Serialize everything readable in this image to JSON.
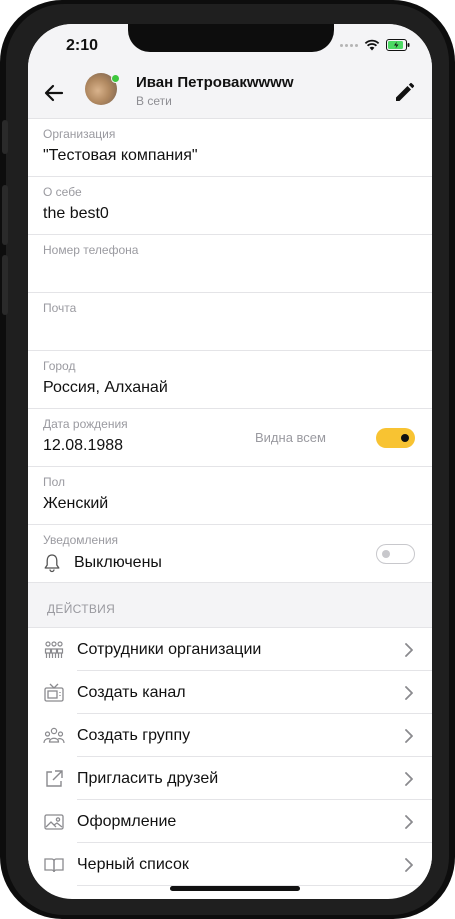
{
  "status_bar": {
    "time": "2:10"
  },
  "header": {
    "name": "Иван Петровакwwww",
    "presence": "В сети"
  },
  "profile": {
    "organization": {
      "label": "Организация",
      "value": "\"Тестовая компания\""
    },
    "about": {
      "label": "О себе",
      "value": "the best0"
    },
    "phone": {
      "label": "Номер телефона",
      "value": ""
    },
    "email": {
      "label": "Почта",
      "value": ""
    },
    "city": {
      "label": "Город",
      "value": "Россия, Алханай"
    },
    "birthday": {
      "label": "Дата рождения",
      "value": "12.08.1988",
      "visibility_label": "Видна всем",
      "visibility_on": true
    },
    "gender": {
      "label": "Пол",
      "value": "Женский"
    },
    "notifications": {
      "label": "Уведомления",
      "value": "Выключены",
      "enabled": false
    }
  },
  "actions": {
    "title": "ДЕЙСТВИЯ",
    "items": [
      {
        "label": "Сотрудники организации",
        "icon": "employees-icon"
      },
      {
        "label": "Создать канал",
        "icon": "tv-icon"
      },
      {
        "label": "Создать группу",
        "icon": "group-icon"
      },
      {
        "label": "Пригласить друзей",
        "icon": "share-icon"
      },
      {
        "label": "Оформление",
        "icon": "image-icon"
      },
      {
        "label": "Черный список",
        "icon": "book-icon"
      }
    ]
  },
  "colors": {
    "accent": "#f8c332",
    "online": "#3ec73e",
    "background": "#f4f4f6"
  }
}
